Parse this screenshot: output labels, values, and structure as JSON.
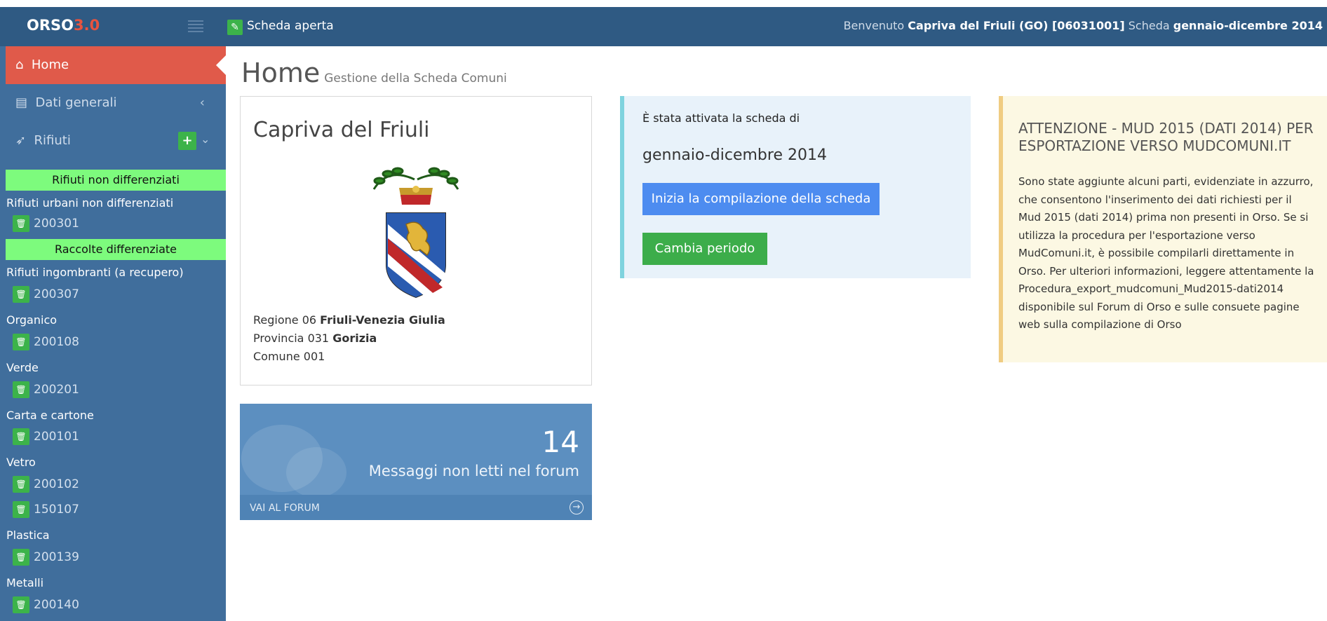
{
  "topbar": {
    "brand": "ORSO",
    "version": "3.0",
    "status_label": "Scheda aperta",
    "welcome_prefix": "Benvenuto",
    "comune": "Capriva del Friuli (GO) [06031001]",
    "scheda_prefix": "Scheda",
    "scheda_period": "gennaio-dicembre 2014"
  },
  "sidebar": {
    "home": "Home",
    "dati_generali": "Dati generali",
    "rifiuti": "Rifiuti",
    "sections": [
      {
        "title": "Rifiuti non differenziati",
        "categories": [
          {
            "name": "Rifiuti urbani non differenziati",
            "codes": [
              "200301"
            ]
          }
        ]
      },
      {
        "title": "Raccolte differenziate",
        "categories": [
          {
            "name": "Rifiuti ingombranti (a recupero)",
            "codes": [
              "200307"
            ]
          },
          {
            "name": "Organico",
            "codes": [
              "200108"
            ]
          },
          {
            "name": "Verde",
            "codes": [
              "200201"
            ]
          },
          {
            "name": "Carta e cartone",
            "codes": [
              "200101"
            ]
          },
          {
            "name": "Vetro",
            "codes": [
              "200102",
              "150107"
            ]
          },
          {
            "name": "Plastica",
            "codes": [
              "200139"
            ]
          },
          {
            "name": "Metalli",
            "codes": [
              "200140"
            ]
          }
        ]
      }
    ]
  },
  "page": {
    "title": "Home",
    "subtitle": "Gestione della Scheda Comuni"
  },
  "comune_card": {
    "name": "Capriva del Friuli",
    "regione_label": "Regione 06",
    "regione_name": "Friuli-Venezia Giulia",
    "provincia_label": "Provincia 031",
    "provincia_name": "Gorizia",
    "comune_label": "Comune 001"
  },
  "forum": {
    "count": "14",
    "label": "Messaggi non letti nel forum",
    "link": "VAI AL FORUM"
  },
  "scheda_info": {
    "line1": "È stata attivata la scheda di",
    "period": "gennaio-dicembre 2014",
    "start_button": "Inizia la compilazione della scheda",
    "change_button": "Cambia periodo"
  },
  "warning": {
    "title": "ATTENZIONE - MUD 2015 (DATI 2014) PER ESPORTAZIONE VERSO MUDCOMUNI.IT",
    "body": "Sono state aggiunte alcuni parti, evidenziate in azzurro, che consentono l'inserimento dei dati richiesti per il Mud 2015 (dati 2014) prima non presenti in Orso. Se si utilizza la procedura per l'esportazione verso MudComuni.it, è possibile compilarli direttamente in Orso. Per ulteriori informazioni, leggere attentamente la Procedura_export_mudcomuni_Mud2015-dati2014 disponibile sul Forum di Orso e sulle consuete pagine web sulla compilazione di Orso"
  },
  "colors": {
    "topbar": "#2f5a83",
    "sidebar": "#406e9c",
    "home_active": "#e05a4a",
    "section_green": "#7dfb7d",
    "button_blue": "#4d8cf0",
    "button_green": "#3cad4a"
  }
}
